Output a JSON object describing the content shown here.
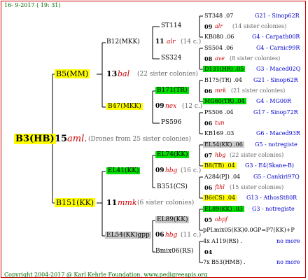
{
  "header": "16- 9-2017 ( 19: 31)",
  "footer": "Copyright 2004-2017 @ Karl Kehrle Foundation.   www.pedigreeapis.org",
  "root": {
    "name": "B3(HB)",
    "num": "15",
    "mark": "aml.",
    "note": "(Drones from 25 sister colonies)"
  },
  "gen1": [
    {
      "name": "B5(MM)",
      "num": "13",
      "mark": "bal",
      "note": "(22 sister colonies)"
    },
    {
      "name": "B151(KK)",
      "num": "11",
      "mark": "mmk",
      "note": "(6 sister colonies)"
    }
  ],
  "gen2": [
    {
      "name": "B12(MKK)",
      "num": "11",
      "mark": "alr",
      "note": "(14 c.)"
    },
    {
      "name": "B47(MKK)",
      "num": "09",
      "mark": "nex",
      "note": "(12 c.)"
    },
    {
      "name": "EL41(KK)",
      "num": "09",
      "mark": "hbg",
      "note": "(16 c.)"
    },
    {
      "name": "EL54(KK)gpp",
      "num": "06",
      "mark": "hbg",
      "note": "(11 c.)"
    }
  ],
  "gen3": [
    {
      "name": "ST114"
    },
    {
      "name": "SS324"
    },
    {
      "name": "B171(TR)"
    },
    {
      "name": "PS596"
    },
    {
      "name": "EL74(KK)"
    },
    {
      "name": "B351(CS)"
    },
    {
      "name": "EL89(KK)"
    },
    {
      "name": "Bmix06(RS)"
    }
  ],
  "gen4": [
    {
      "a": "ST348 .07",
      "b": "G21 - Sinop62R"
    },
    {
      "a": "09",
      "mark": "alr",
      "note": "(14 sister colonies)"
    },
    {
      "a": "KB080 .06",
      "b": "G4 - Carpath00R"
    },
    {
      "a": "SS504 .06",
      "b": "G4 - Carnic99R"
    },
    {
      "a": "08",
      "mark": "ave",
      "note": "(8 sister colonies)"
    },
    {
      "a": "D131(HR) .05",
      "b": "G3 - Maced02Q"
    },
    {
      "a": "B175(TR) .04",
      "b": "G21 - Sinop62R"
    },
    {
      "a": "06",
      "mark": "mrk",
      "note": "(21 sister colonies)"
    },
    {
      "a": "MG60(TR) .04",
      "b": "G4 - MG00R"
    },
    {
      "a": "PS506 .04",
      "b": "G17 - Sinop72R"
    },
    {
      "a": "06",
      "mark": "tun",
      "note": ""
    },
    {
      "a": "KB169 .03",
      "b": "G6 - Maced93R"
    },
    {
      "a": "EL54(KK) .06",
      "b": "G5 - notregiste"
    },
    {
      "a": "07",
      "mark": "hbg",
      "note": "(22 sister colonies)"
    },
    {
      "a": "B8(TB) .04",
      "b": "G3 - E4(Skane-B)"
    },
    {
      "a": "A284(PJ) .04",
      "b": "G5 - Cankiri97Q"
    },
    {
      "a": "06",
      "mark": "fthl",
      "note": "(15 sister colonies)"
    },
    {
      "a": "B6(CS) .04",
      "b": "G13 - AthosSt80R"
    },
    {
      "a": "EL89(KK) .03",
      "b": "G3 - notregiste"
    },
    {
      "a": "05",
      "mark": "obpf",
      "note": ""
    },
    {
      "a": "pPLmix05(KK)0.0GP=P7(KK)+P",
      "b": ""
    },
    {
      "a": "4x A119(RS) .",
      "b": "no more"
    },
    {
      "a": "04",
      "mark": "",
      "note": ""
    },
    {
      "a": "7x B53(HMB) .",
      "b": "no more"
    }
  ]
}
